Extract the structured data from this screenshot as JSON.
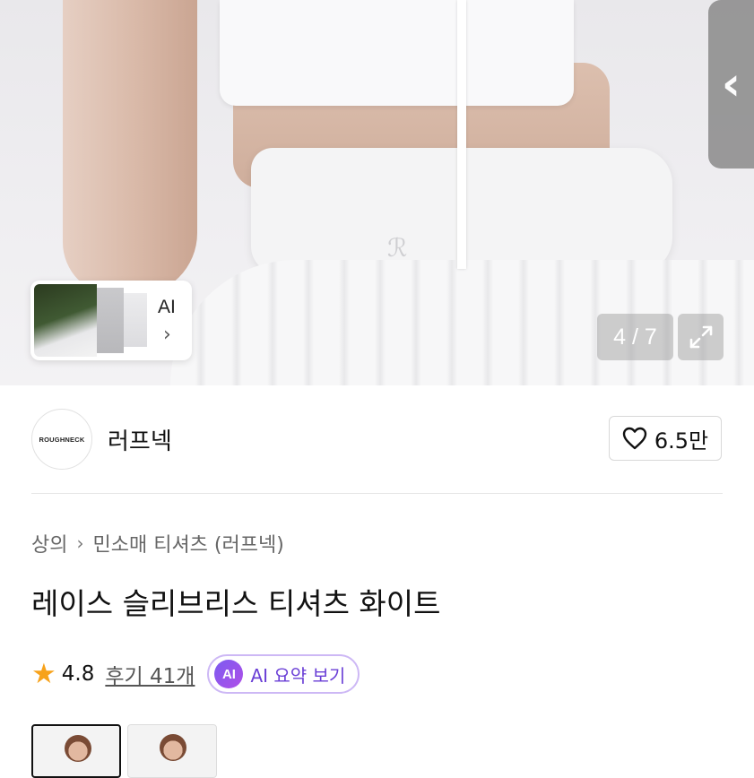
{
  "gallery": {
    "counter": "4 / 7",
    "thumb_card": {
      "label": "AI",
      "chevron": "›"
    },
    "side_handle_glyph": "‹"
  },
  "brand": {
    "logo_text": "ROUGHNECK",
    "name": "러프넥",
    "like_count": "6.5만"
  },
  "breadcrumb": {
    "category": "상의",
    "separator": "›",
    "subcategory": "민소매 티셔츠 (러프넥)"
  },
  "product": {
    "title": "레이스 슬리브리스 티셔츠 화이트"
  },
  "rating": {
    "score": "4.8",
    "reviews_label": "후기 41개",
    "ai_badge": "AI",
    "ai_summary_label": "AI 요약 보기"
  },
  "colors": {
    "star": "#f7a21b",
    "ai_accent": "#7b5cf0",
    "ai_text": "#6a3fd6"
  }
}
